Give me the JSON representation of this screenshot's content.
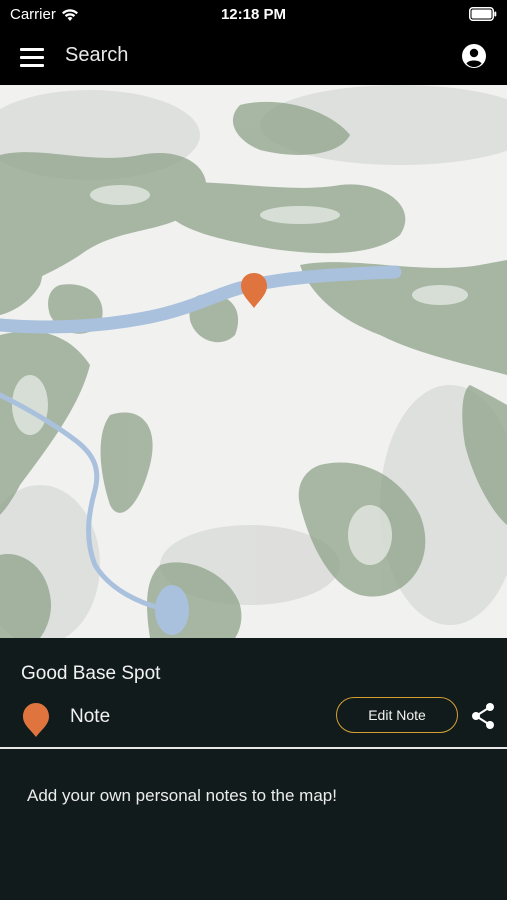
{
  "status_bar": {
    "carrier": "Carrier",
    "time": "12:18 PM",
    "icons": [
      "wifi-icon",
      "battery-icon"
    ]
  },
  "top_bar": {
    "search_label": "Search",
    "icons": [
      "hamburger-menu-icon",
      "account-circle-icon"
    ]
  },
  "map": {
    "marker_color": "#e0743f",
    "water_color": "#a9c1dd",
    "vegetation_color": "#8fa38a"
  },
  "note_panel": {
    "title": "Good Base Spot",
    "type_label": "Note",
    "edit_button_label": "Edit Note",
    "edit_button_border_color": "#d4a034",
    "body_text": "Add your own personal notes to the map!",
    "background_color": "#111b1c",
    "icons": [
      "map-marker-icon",
      "share-icon"
    ]
  }
}
